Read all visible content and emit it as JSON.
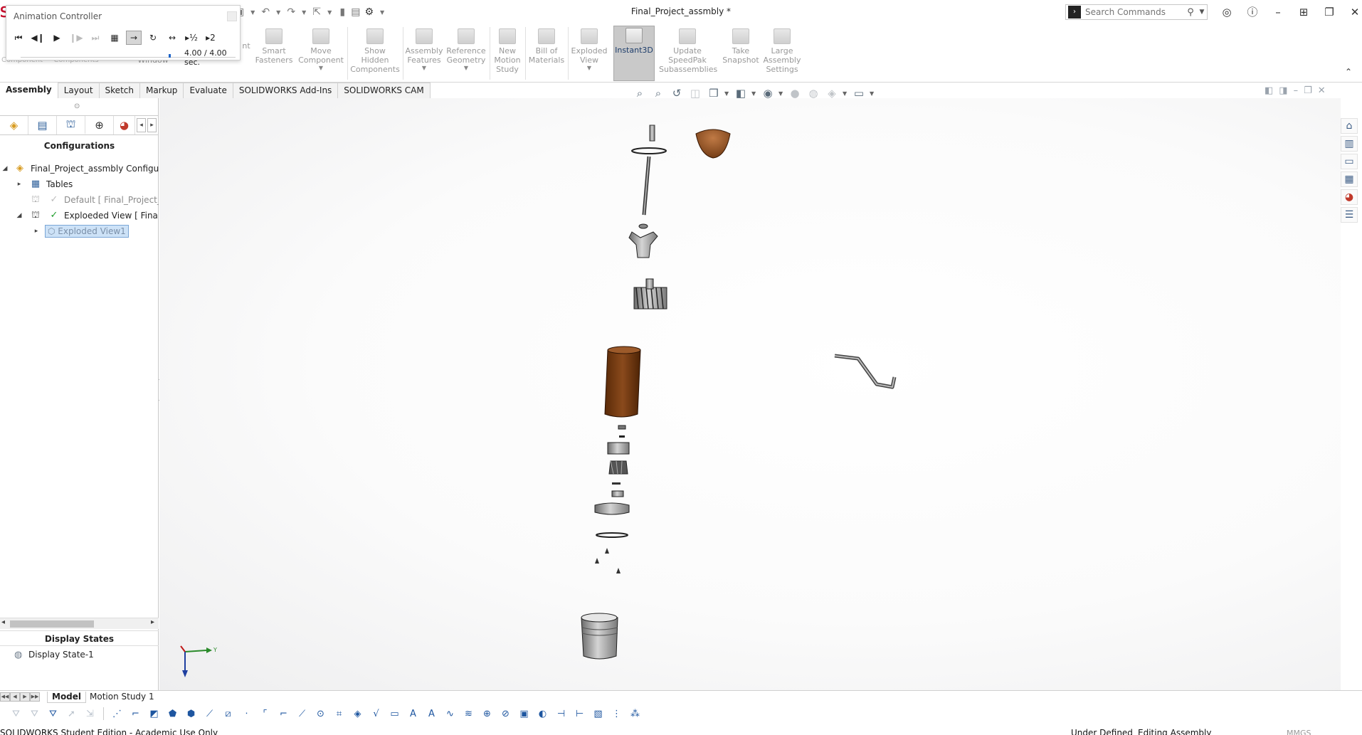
{
  "titlebar": {
    "doc_title": "Final_Project_assmbly *",
    "search_placeholder": "Search Commands",
    "icons": [
      "solidworks-logo-icon",
      "undo-icon",
      "redo-icon",
      "select-icon",
      "rebuild-icon",
      "file-properties-icon",
      "options-icon"
    ]
  },
  "ribbon": {
    "buttons": [
      {
        "key": "smart_fasteners",
        "label": "Smart\nFasteners"
      },
      {
        "key": "move_component",
        "label": "Move\nComponent"
      },
      {
        "key": "show_hidden",
        "label": "Show\nHidden\nComponents"
      },
      {
        "key": "assembly_features",
        "label": "Assembly\nFeatures"
      },
      {
        "key": "reference_geometry",
        "label": "Reference\nGeometry"
      },
      {
        "key": "new_motion_study",
        "label": "New\nMotion\nStudy"
      },
      {
        "key": "bill_of_materials",
        "label": "Bill of\nMaterials"
      },
      {
        "key": "exploded_view",
        "label": "Exploded\nView"
      },
      {
        "key": "instant3d",
        "label": "Instant3D"
      },
      {
        "key": "update_speedpak",
        "label": "Update\nSpeedPak\nSubassemblies"
      },
      {
        "key": "take_snapshot",
        "label": "Take\nSnapshot"
      },
      {
        "key": "large_assembly_settings",
        "label": "Large\nAssembly\nSettings"
      }
    ],
    "partial_labels": {
      "component": "Component",
      "components": "Components",
      "window": "Window",
      "nt": "nt"
    }
  },
  "tabs": [
    "Assembly",
    "Layout",
    "Sketch",
    "Markup",
    "Evaluate",
    "SOLIDWORKS Add-Ins",
    "SOLIDWORKS CAM"
  ],
  "left_panel": {
    "title": "Configurations",
    "tree": {
      "root": "Final_Project_assmbly Configurati",
      "tables": "Tables",
      "default_config": "Default [ Final_Project_as",
      "exploded_config": "Exploeded View [ Final_P",
      "exploded_view1": "Exploded View1"
    },
    "display_states_title": "Display States",
    "display_state_item": "Display State-1"
  },
  "bottom_tabs": {
    "model": "Model",
    "motion_study": "Motion Study 1"
  },
  "status_bar": {
    "left": "SOLIDWORKS Student Edition - Academic Use Only",
    "under_defined": "Under Defined",
    "editing": "Editing Assembly",
    "units": "MMGS"
  },
  "animation_controller": {
    "title": "Animation Controller",
    "time": "4.00 / 4.00 sec.",
    "progress": 1.0
  },
  "colors": {
    "accent": "#1e56a0",
    "highlight": "#cde2f7",
    "brown_part": "#7a3d12",
    "red_logo": "#c8102e"
  }
}
